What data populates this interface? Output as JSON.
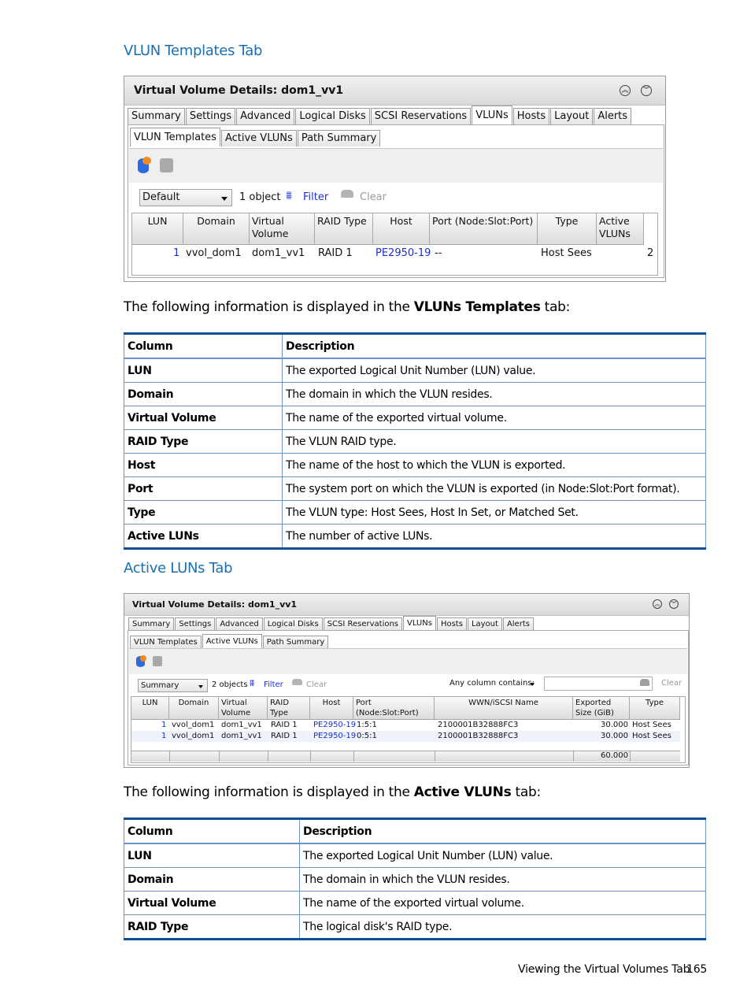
{
  "section1": {
    "heading": "VLUN Templates Tab",
    "intro_prefix": "The following information is displayed in the ",
    "intro_bold": "VLUNs Templates",
    "intro_suffix": " tab:"
  },
  "screenshot1": {
    "title": "Virtual Volume Details: dom1_vv1",
    "collapse_icon": "double-chevron-up-icon",
    "expand_icon": "double-chevron-down-icon",
    "tabs": [
      "Summary",
      "Settings",
      "Advanced",
      "Logical Disks",
      "SCSI Reservations",
      "VLUNs",
      "Hosts",
      "Layout",
      "Alerts"
    ],
    "active_tab": "VLUNs",
    "subtabs": [
      "VLUN Templates",
      "Active VLUNs",
      "Path Summary"
    ],
    "active_subtab": "VLUN Templates",
    "view_select": "Default",
    "object_count": "1 object",
    "filter_label": "Filter",
    "clear_label": "Clear",
    "columns": [
      "LUN",
      "Domain",
      "Virtual Volume",
      "RAID Type",
      "Host",
      "Port (Node:Slot:Port)",
      "Type",
      "Active VLUNs"
    ],
    "rows": [
      {
        "lun": "1",
        "domain": "vvol_dom1",
        "virtual_volume": "dom1_vv1",
        "raid_type": "RAID 1",
        "host": "PE2950-19",
        "port": "--",
        "type": "Host Sees",
        "active_vluns": "2"
      }
    ]
  },
  "table1": {
    "headers": [
      "Column",
      "Description"
    ],
    "rows": [
      {
        "column": "LUN",
        "description": "The exported Logical Unit Number (LUN) value."
      },
      {
        "column": "Domain",
        "description": "The domain in which the VLUN resides."
      },
      {
        "column": "Virtual Volume",
        "description": "The name of the exported virtual volume."
      },
      {
        "column": "RAID Type",
        "description": "The VLUN RAID type."
      },
      {
        "column": "Host",
        "description": "The name of the host to which the VLUN is exported."
      },
      {
        "column": "Port",
        "description": "The system port on which the VLUN is exported (in Node:Slot:Port format)."
      },
      {
        "column": "Type",
        "description": "The VLUN type: Host Sees, Host In Set, or Matched Set."
      },
      {
        "column": "Active LUNs",
        "description": "The number of active LUNs."
      }
    ]
  },
  "section2": {
    "heading": "Active LUNs Tab",
    "intro_prefix": "The following information is displayed in the ",
    "intro_bold": "Active VLUNs",
    "intro_suffix": " tab:"
  },
  "screenshot2": {
    "title": "Virtual Volume Details: dom1_vv1",
    "tabs": [
      "Summary",
      "Settings",
      "Advanced",
      "Logical Disks",
      "SCSI Reservations",
      "VLUNs",
      "Hosts",
      "Layout",
      "Alerts"
    ],
    "active_tab": "VLUNs",
    "subtabs": [
      "VLUN Templates",
      "Active VLUNs",
      "Path Summary"
    ],
    "active_subtab": "Active VLUNs",
    "view_select": "Summary",
    "object_count": "2 objects",
    "filter_label": "Filter",
    "clear_label": "Clear",
    "search_label": "Any column contains:",
    "search_value": "",
    "search_clear": "Clear",
    "columns": [
      "LUN",
      "Domain",
      "Virtual Volume",
      "RAID Type",
      "Host",
      "Port (Node:Slot:Port)",
      "WWN/iSCSI Name",
      "Exported Size (GiB)",
      "Type"
    ],
    "rows": [
      {
        "lun": "1",
        "domain": "vvol_dom1",
        "virtual_volume": "dom1_vv1",
        "raid_type": "RAID 1",
        "host": "PE2950-19",
        "port": "1:5:1",
        "wwn": "2100001B32888FC3",
        "size": "30.000",
        "type": "Host Sees"
      },
      {
        "lun": "1",
        "domain": "vvol_dom1",
        "virtual_volume": "dom1_vv1",
        "raid_type": "RAID 1",
        "host": "PE2950-19",
        "port": "0:5:1",
        "wwn": "2100001B32888FC3",
        "size": "30.000",
        "type": "Host Sees"
      }
    ],
    "total_size": "60.000"
  },
  "table2": {
    "headers": [
      "Column",
      "Description"
    ],
    "rows": [
      {
        "column": "LUN",
        "description": "The exported Logical Unit Number (LUN) value."
      },
      {
        "column": "Domain",
        "description": "The domain in which the VLUN resides."
      },
      {
        "column": "Virtual Volume",
        "description": "The name of the exported virtual volume."
      },
      {
        "column": "RAID Type",
        "description": "The logical disk's RAID type."
      }
    ]
  },
  "footer": {
    "section_title": "Viewing the Virtual Volumes Tab",
    "page_number": "165"
  },
  "colors": {
    "heading_blue": "#1a6fb4",
    "table_rule": "#0a4f9a",
    "link_blue": "#1a2fd4"
  }
}
